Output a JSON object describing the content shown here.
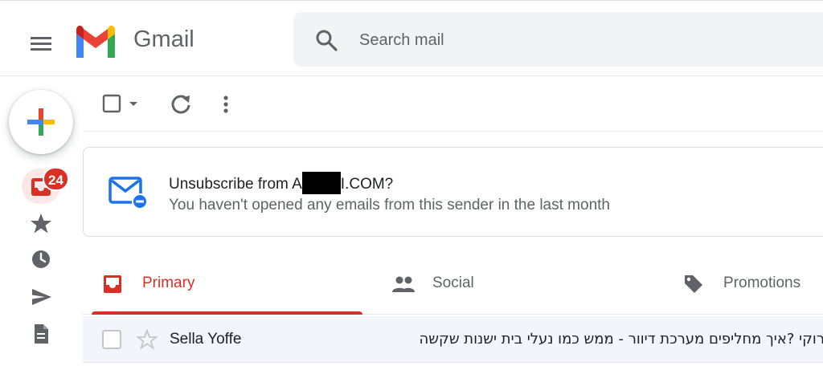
{
  "app": {
    "brand": "Gmail"
  },
  "search": {
    "placeholder": "Search mail"
  },
  "nav": {
    "inbox_badge": "24"
  },
  "banner": {
    "title_prefix": "Unsubscribe from A",
    "title_suffix": "I.COM?",
    "subtitle": "You haven't opened any emails from this sender in the last month"
  },
  "tabs": [
    {
      "label": "Primary"
    },
    {
      "label": "Social"
    },
    {
      "label": "Promotions"
    }
  ],
  "emails": [
    {
      "sender": "Sella Yoffe",
      "subject": "רוקי ?איך מחליפים מערכת דיוור - ממש כמו נעלי בית ישנות שקשה"
    }
  ],
  "colors": {
    "accent_red": "#d93025",
    "search_bg": "#f1f3f4",
    "selected_row_bg": "#f2f6fc",
    "banner_icon_blue": "#1a73e8"
  },
  "icons": {
    "menu": "hamburger-icon",
    "search": "magnifier-icon",
    "compose": "plus-icon",
    "inbox": "inbox-icon",
    "starred": "star-icon",
    "snoozed": "clock-icon",
    "sent": "send-icon",
    "drafts": "file-icon"
  }
}
